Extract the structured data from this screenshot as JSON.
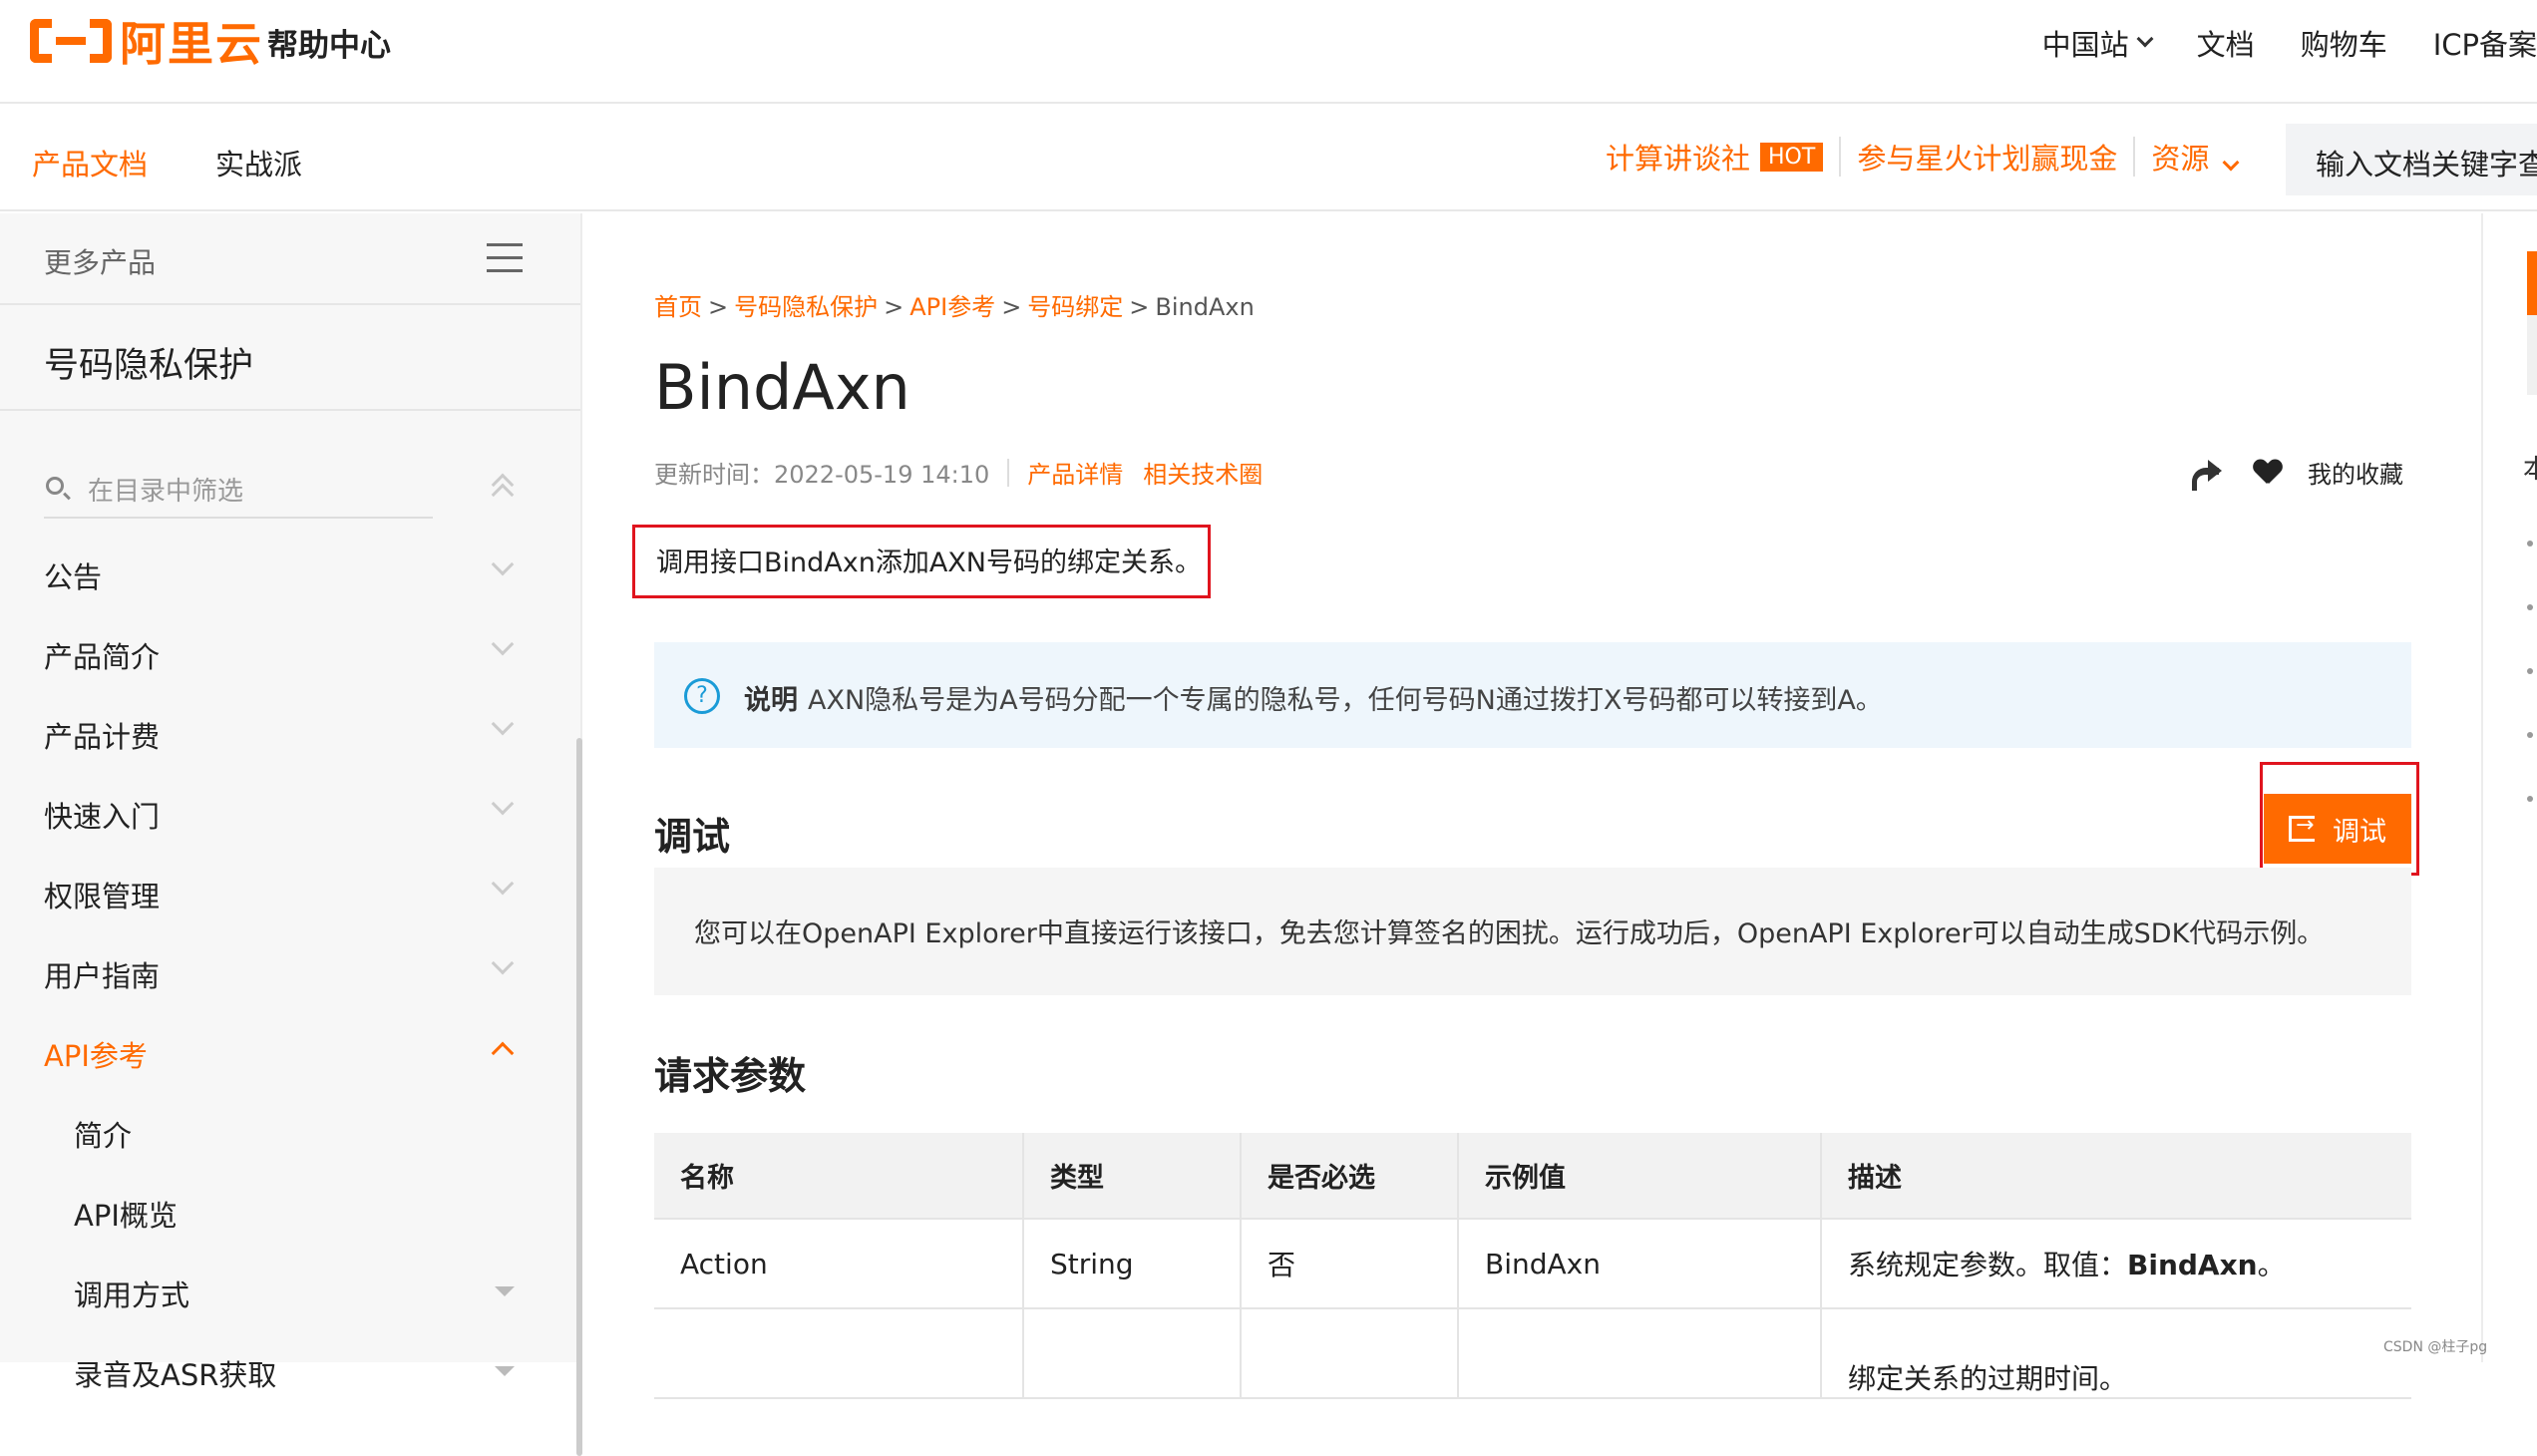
{
  "brand": {
    "logo_text": "阿里云",
    "help_center": "帮助中心"
  },
  "top_links": [
    "中国站",
    "文档",
    "购物车",
    "ICP备案"
  ],
  "subnav": {
    "tabs": [
      "产品文档",
      "实战派"
    ],
    "promo1": "计算讲谈社",
    "hot_badge": "HOT",
    "promo2": "参与星火计划赢现金",
    "resources": "资源",
    "search_placeholder": "输入文档关键字查"
  },
  "sidebar": {
    "more_products": "更多产品",
    "product_title": "号码隐私保护",
    "filter_placeholder": "在目录中筛选",
    "items": [
      {
        "label": "公告"
      },
      {
        "label": "产品简介"
      },
      {
        "label": "产品计费"
      },
      {
        "label": "快速入门"
      },
      {
        "label": "权限管理"
      },
      {
        "label": "用户指南"
      },
      {
        "label": "API参考"
      },
      {
        "label": "简介"
      },
      {
        "label": "API概览"
      },
      {
        "label": "调用方式"
      },
      {
        "label": "录音及ASR获取"
      }
    ]
  },
  "main": {
    "breadcrumb": [
      "首页",
      "号码隐私保护",
      "API参考",
      "号码绑定",
      "BindAxn"
    ],
    "breadcrumb_sep": ">",
    "title": "BindAxn",
    "updated": "更新时间：2022-05-19 14:10",
    "product_detail": "产品详情",
    "tech_circle": "相关技术圈",
    "favorite": "我的收藏",
    "intro": "调用接口BindAxn添加AXN号码的绑定关系。",
    "note_label": "说明",
    "note_text": "AXN隐私号是为A号码分配一个专属的隐私号，任何号码N通过拨打X号码都可以转接到A。",
    "debug_heading": "调试",
    "debug_button": "调试",
    "debug_desc": "您可以在OpenAPI Explorer中直接运行该接口，免去您计算签名的困扰。运行成功后，OpenAPI Explorer可以自动生成SDK代码示例。",
    "params_heading": "请求参数",
    "table": {
      "headers": [
        "名称",
        "类型",
        "是否必选",
        "示例值",
        "描述"
      ],
      "rows": [
        [
          "Action",
          "String",
          "否",
          "BindAxn",
          "系统规定参数。取值：",
          "BindAxn",
          "。"
        ],
        [
          "",
          "",
          "",
          "",
          "绑定关系的过期时间。"
        ]
      ]
    }
  },
  "right_rail": {
    "char": "本"
  },
  "watermark": "CSDN @柱子pg",
  "colors": {
    "accent": "#ff6a00",
    "highlight_box": "#e0141e",
    "info": "#1a9bd7"
  }
}
